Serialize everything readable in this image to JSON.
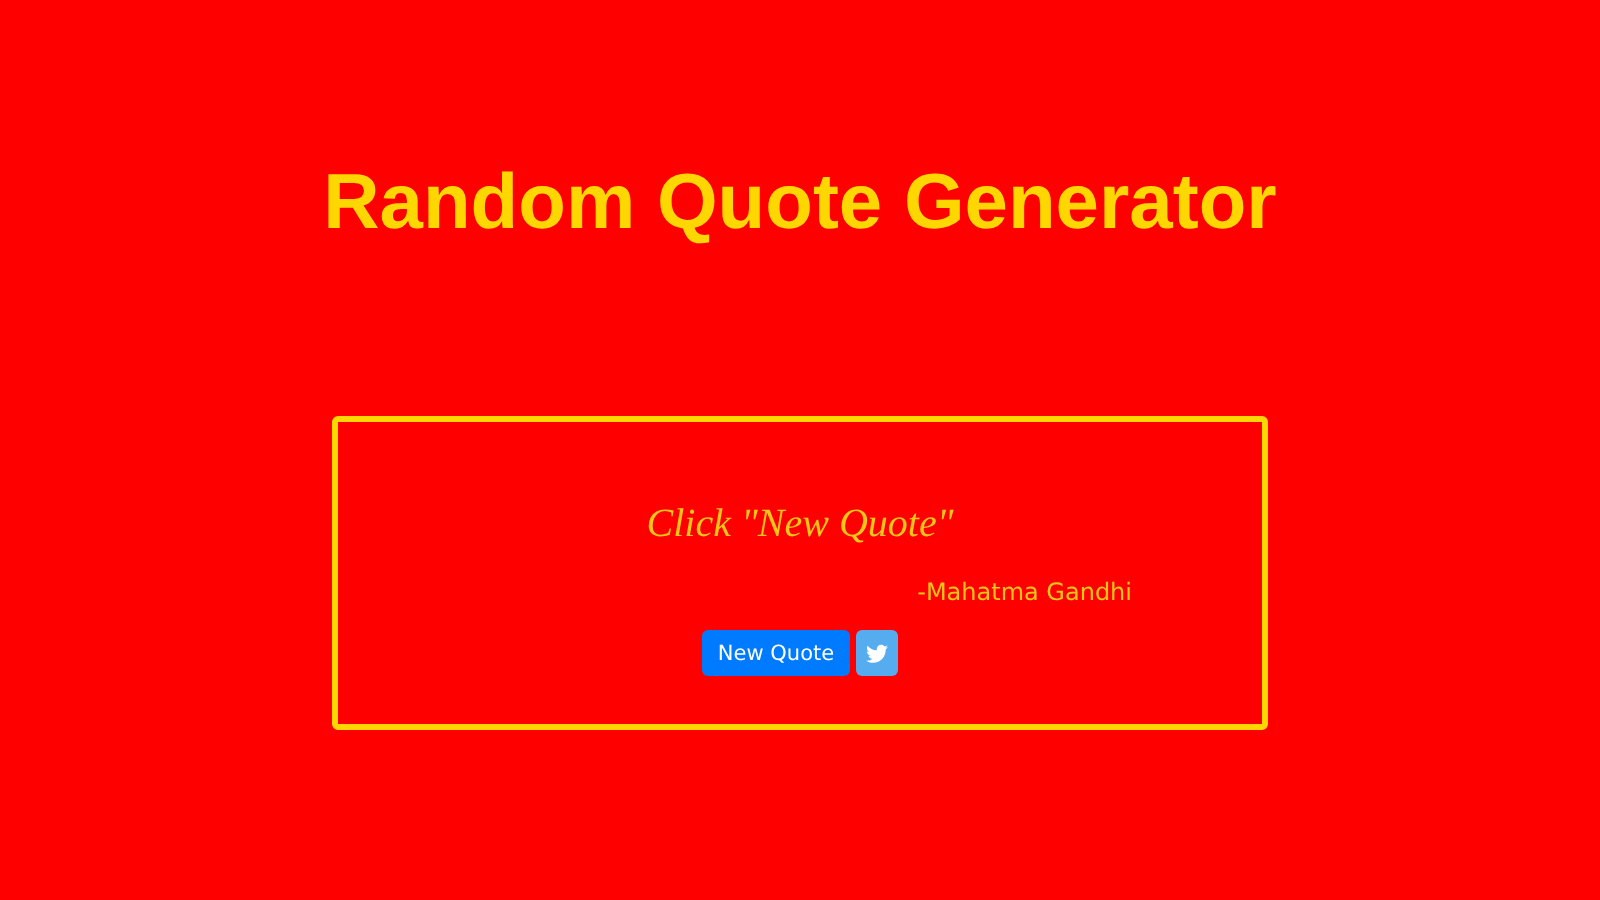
{
  "title": "Random Quote Generator",
  "quote": {
    "text": "Click \"New Quote\"",
    "author": "-Mahatma Gandhi"
  },
  "buttons": [
    {
      "kind": "text",
      "label": "New Quote"
    },
    {
      "kind": "twitter"
    }
  ]
}
